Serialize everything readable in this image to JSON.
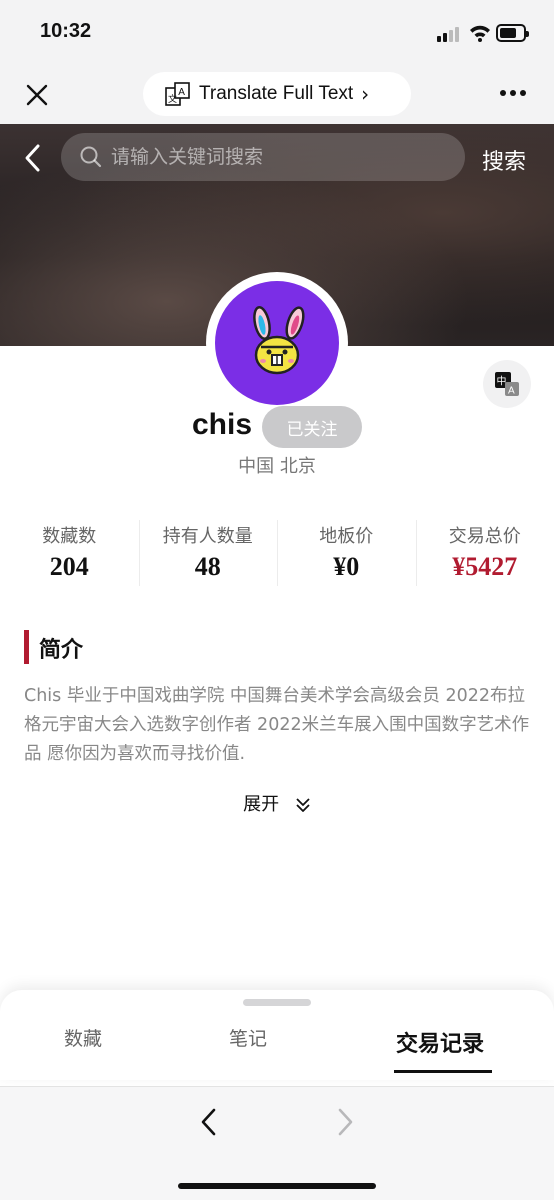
{
  "status_bar": {
    "time": "10:32"
  },
  "top_nav": {
    "translate_label": "Translate Full Text",
    "translate_chevron": "›"
  },
  "search": {
    "placeholder": "请输入关键词搜索",
    "action": "搜索"
  },
  "profile": {
    "username": "chis",
    "follow_label": "已关注",
    "location": "中国 北京"
  },
  "stats": [
    {
      "label": "数藏数",
      "value": "204"
    },
    {
      "label": "持有人数量",
      "value": "48"
    },
    {
      "label": "地板价",
      "value": "¥0"
    },
    {
      "label": "交易总价",
      "value": "¥5427"
    }
  ],
  "intro": {
    "title": "简介",
    "text": "Chis 毕业于中国戏曲学院 中国舞台美术学会高级会员 2022布拉格元宇宙大会入选数字创作者 2022米兰车展入围中国数字艺术作品 愿你因为喜欢而寻找价值.",
    "expand_label": "展开"
  },
  "tabs": [
    {
      "label": "数藏"
    },
    {
      "label": "笔记"
    },
    {
      "label": "交易记录"
    }
  ],
  "colors": {
    "accent_red": "#b11b30",
    "avatar_bg": "#7b2ee6"
  }
}
